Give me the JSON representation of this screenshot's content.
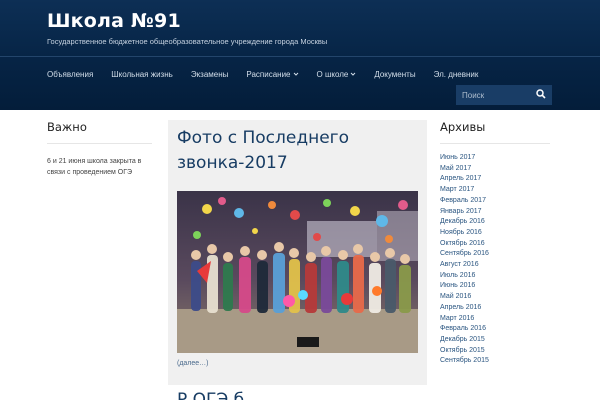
{
  "site": {
    "title": "Школа №91",
    "description": "Государственное бюджетное общеобразовательное учреждение города Москвы"
  },
  "nav": {
    "items": [
      {
        "label": "Объявления",
        "has_submenu": false
      },
      {
        "label": "Школьная жизнь",
        "has_submenu": false
      },
      {
        "label": "Экзамены",
        "has_submenu": false
      },
      {
        "label": "Расписание",
        "has_submenu": true
      },
      {
        "label": "О школе",
        "has_submenu": true
      },
      {
        "label": "Документы",
        "has_submenu": false
      },
      {
        "label": "Эл. дневник",
        "has_submenu": false
      }
    ]
  },
  "search": {
    "placeholder": "Поиск",
    "icon": "search-icon"
  },
  "left_widget": {
    "title": "Важно",
    "text": "6 и 21 июня школа закрыта в связи с проведением ОГЭ"
  },
  "post": {
    "title": "Фото с Последнего звонка-2017",
    "more_label": "(далее…)"
  },
  "next_post": {
    "title_fragment": "Р         ОГЭ        б"
  },
  "archives": {
    "title": "Архивы",
    "items": [
      "Июнь 2017",
      "Май 2017",
      "Апрель 2017",
      "Март 2017",
      "Февраль 2017",
      "Январь 2017",
      "Декабрь 2016",
      "Ноябрь 2016",
      "Октябрь 2016",
      "Сентябрь 2016",
      "Август 2016",
      "Июль 2016",
      "Июнь 2016",
      "Май 2016",
      "Апрель 2016",
      "Март 2016",
      "Февраль 2016",
      "Декабрь 2015",
      "Октябрь 2015",
      "Сентябрь 2015"
    ]
  },
  "colors": {
    "header_bg": "#062445",
    "title_blue": "#173c63",
    "link_blue": "#2a5580",
    "content_bg": "#f0f0f0"
  }
}
